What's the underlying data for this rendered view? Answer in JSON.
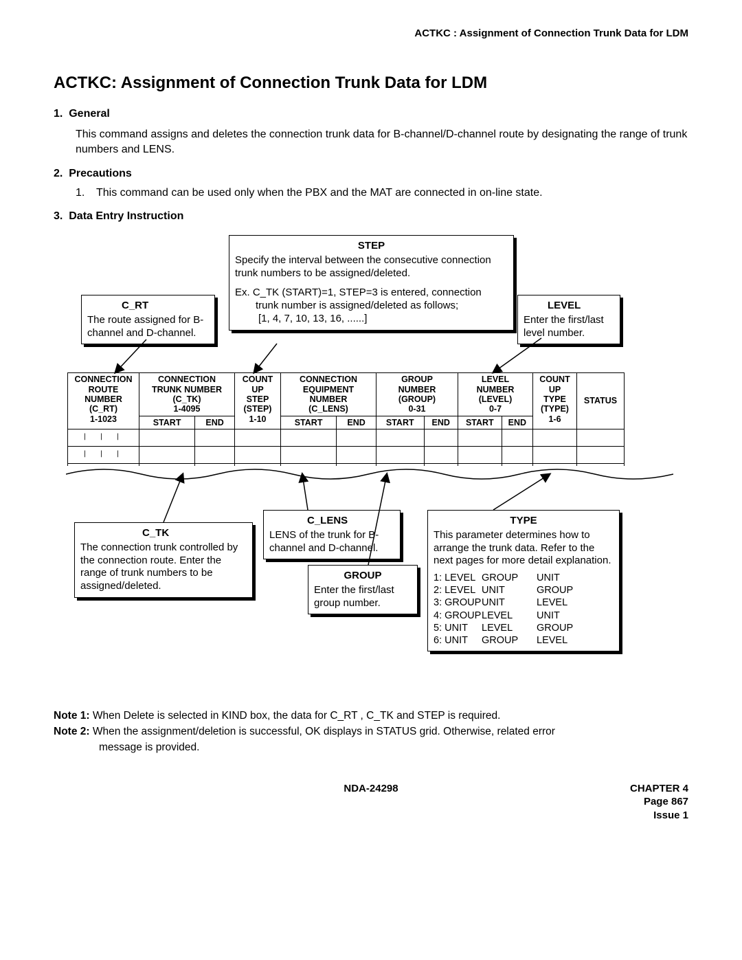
{
  "header": "ACTKC : Assignment of Connection Trunk Data for LDM",
  "title": "ACTKC: Assignment of Connection Trunk Data for LDM",
  "sec1": {
    "num": "1.",
    "head": "General",
    "body": "This command assigns and deletes the connection trunk data for B-channel/D-channel route by designating the range of trunk numbers and LENS."
  },
  "sec2": {
    "num": "2.",
    "head": "Precautions",
    "item_num": "1.",
    "item": "This command can be used only when the PBX and the MAT are connected in on-line state."
  },
  "sec3": {
    "num": "3.",
    "head": "Data Entry Instruction"
  },
  "callouts": {
    "step": {
      "title": "STEP",
      "l1": "Specify the interval between the consecutive connection trunk numbers to be assigned/deleted.",
      "l2": "Ex.  C_TK (START)=1, STEP=3 is entered, connection",
      "l3": "trunk number is assigned/deleted as follows;",
      "l4": "[1, 4, 7, 10, 13, 16, ......]"
    },
    "crt": {
      "title": "C_RT",
      "body": "The route assigned for B-channel and D-channel."
    },
    "level": {
      "title": "LEVEL",
      "body": "Enter the first/last level number."
    },
    "ctk": {
      "title": "C_TK",
      "body": "The connection trunk controlled by the connection route. Enter the range of trunk numbers to be assigned/deleted."
    },
    "clens": {
      "title": "C_LENS",
      "body": "LENS of the trunk for B-channel and D-channel."
    },
    "group": {
      "title": "GROUP",
      "body": "Enter the first/last group number."
    },
    "type": {
      "title": "TYPE",
      "body": "This parameter determines how to arrange the trunk data. Refer to the next pages for more detail explanation.",
      "rows": [
        [
          "1: LEVEL",
          "GROUP",
          "UNIT"
        ],
        [
          "2: LEVEL",
          "UNIT",
          "GROUP"
        ],
        [
          "3: GROUP",
          "UNIT",
          "LEVEL"
        ],
        [
          "4: GROUP",
          "LEVEL",
          "UNIT"
        ],
        [
          "5: UNIT",
          "LEVEL",
          "GROUP"
        ],
        [
          "6: UNIT",
          "GROUP",
          "LEVEL"
        ]
      ]
    }
  },
  "table": {
    "c1": {
      "l1": "CONNECTION",
      "l2": "ROUTE",
      "l3": "NUMBER",
      "l4": "(C_RT)",
      "l5": "1-1023"
    },
    "c2": {
      "l1": "CONNECTION",
      "l2": "TRUNK NUMBER",
      "l3": "(C_TK)",
      "l4": "1-4095",
      "s1": "START",
      "s2": "END"
    },
    "c3": {
      "l1": "COUNT",
      "l2": "UP",
      "l3": "STEP",
      "l4": "(STEP)",
      "l5": "1-10"
    },
    "c4": {
      "l1": "CONNECTION",
      "l2": "EQUIPMENT",
      "l3": "NUMBER",
      "l4": "(C_LENS)",
      "s1": "START",
      "s2": "END"
    },
    "c5": {
      "l1": "GROUP",
      "l2": "NUMBER",
      "l3": "(GROUP)",
      "l4": "0-31",
      "s1": "START",
      "s2": "END"
    },
    "c6": {
      "l1": "LEVEL",
      "l2": "NUMBER",
      "l3": "(LEVEL)",
      "l4": "0-7",
      "s1": "START",
      "s2": "END"
    },
    "c7": {
      "l1": "COUNT",
      "l2": "UP",
      "l3": "TYPE",
      "l4": "(TYPE)",
      "l5": "1-6"
    },
    "c8": "STATUS"
  },
  "notes": {
    "n1l": "Note 1:",
    "n1": "When  Delete  is selected in KIND   box, the data for C_RT ,  C_TK  and  STEP  is required.",
    "n2l": "Note 2:",
    "n2a": "When the assignment/deletion is successful, OK  displays in  STATUS  grid. Otherwise, related error",
    "n2b": "message is provided."
  },
  "footer": {
    "doc": "NDA-24298",
    "chap": "CHAPTER 4",
    "page": "Page 867",
    "issue": "Issue 1"
  }
}
